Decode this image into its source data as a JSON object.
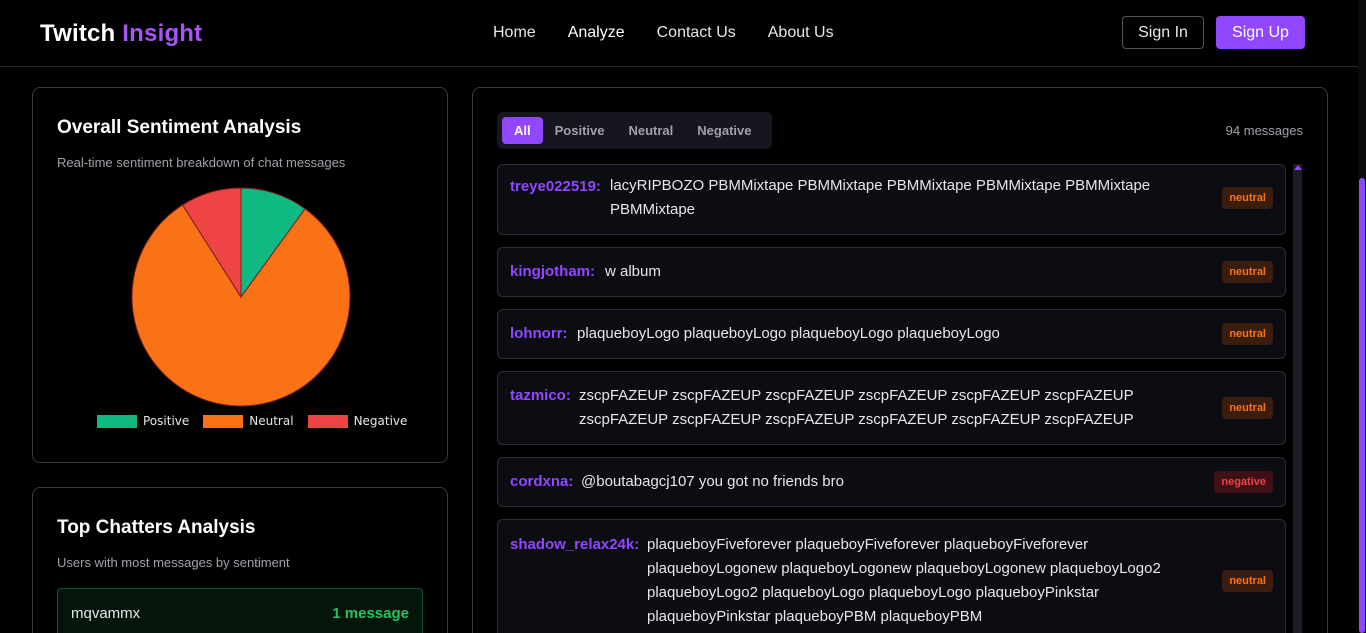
{
  "header": {
    "logo_main": "Twitch",
    "logo_accent": "Insight",
    "nav": [
      "Home",
      "Analyze",
      "Contact Us",
      "About Us"
    ],
    "sign_in": "Sign In",
    "sign_up": "Sign Up"
  },
  "sentiment_card": {
    "title": "Overall Sentiment Analysis",
    "subtitle": "Real-time sentiment breakdown of chat messages"
  },
  "chart_data": {
    "type": "pie",
    "categories": [
      "Positive",
      "Neutral",
      "Negative"
    ],
    "values": [
      10,
      81,
      9
    ],
    "colors": [
      "#10b981",
      "#f97316",
      "#ef4444"
    ],
    "legend_position": "bottom"
  },
  "chatters_card": {
    "title": "Top Chatters Analysis",
    "subtitle": "Users with most messages by sentiment",
    "rows": [
      {
        "name": "mqvammx",
        "count": "1 message"
      }
    ]
  },
  "messages": {
    "filters": [
      "All",
      "Positive",
      "Neutral",
      "Negative"
    ],
    "active_filter": "All",
    "count_label": "94 messages",
    "items": [
      {
        "user": "treye022519:",
        "text": "lacyRIPBOZO PBMMixtape PBMMixtape PBMMixtape PBMMixtape PBMMixtape PBMMixtape",
        "sentiment": "neutral"
      },
      {
        "user": "kingjotham:",
        "text": "w album",
        "sentiment": "neutral"
      },
      {
        "user": "lohnorr:",
        "text": "plaqueboyLogo plaqueboyLogo plaqueboyLogo plaqueboyLogo",
        "sentiment": "neutral"
      },
      {
        "user": "tazmico:",
        "text": "zscpFAZEUP zscpFAZEUP zscpFAZEUP zscpFAZEUP zscpFAZEUP zscpFAZEUP zscpFAZEUP zscpFAZEUP zscpFAZEUP zscpFAZEUP zscpFAZEUP zscpFAZEUP",
        "sentiment": "neutral"
      },
      {
        "user": "cordxna:",
        "text": "@boutabagcj107 you got no friends bro",
        "sentiment": "negative"
      },
      {
        "user": "shadow_relax24k:",
        "text": "plaqueboyFiveforever plaqueboyFiveforever plaqueboyFiveforever plaqueboyLogonew plaqueboyLogonew plaqueboyLogonew plaqueboyLogo2 plaqueboyLogo2 plaqueboyLogo plaqueboyLogo plaqueboyPinkstar plaqueboyPinkstar plaqueboyPBM plaqueboyPBM",
        "sentiment": "neutral"
      }
    ]
  }
}
